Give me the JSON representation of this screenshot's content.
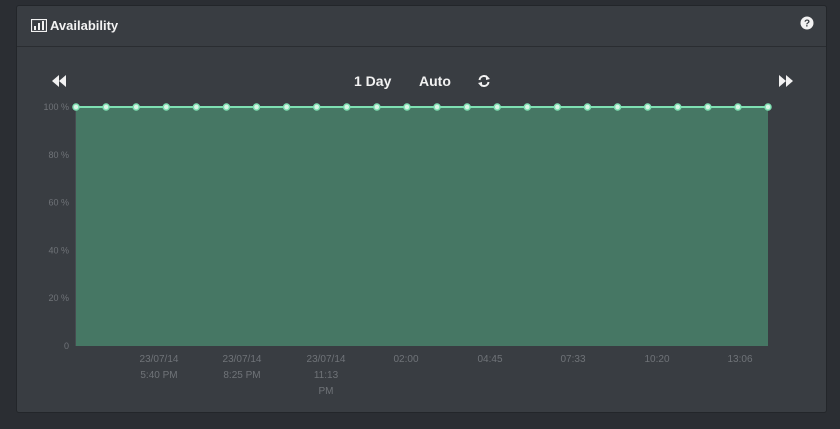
{
  "panel": {
    "title": "Availability",
    "title_icon": "bar-chart-icon",
    "help_icon": "question-circle-icon"
  },
  "toolbar": {
    "prev_icon": "fast-backward-icon",
    "range_label": "1 Day",
    "refresh_mode_label": "Auto",
    "refresh_icon": "refresh-icon",
    "next_icon": "fast-forward-icon"
  },
  "colors": {
    "area_fill": "#467764",
    "line": "#7ee0b2",
    "point_fill": "#d9f5e6"
  },
  "chart_data": {
    "type": "area",
    "title": "",
    "xlabel": "",
    "ylabel": "",
    "y_tick_labels": [
      "0",
      "20 %",
      "40 %",
      "60 %",
      "80 %",
      "100 %"
    ],
    "x_tick_labels": [
      [
        "23/07/14",
        "5:40 PM"
      ],
      [
        "23/07/14",
        "8:25 PM"
      ],
      [
        "23/07/14",
        "11:13",
        "PM"
      ],
      [
        "02:00"
      ],
      [
        "04:45"
      ],
      [
        "07:33"
      ],
      [
        "10:20"
      ],
      [
        "13:06"
      ]
    ],
    "ylim": [
      0,
      100
    ],
    "grid": false,
    "series": [
      {
        "values": [
          100,
          100,
          100,
          100,
          100,
          100,
          100,
          100,
          100,
          100,
          100,
          100,
          100,
          100,
          100,
          100,
          100,
          100,
          100,
          100,
          100,
          100,
          100,
          100
        ]
      }
    ]
  }
}
